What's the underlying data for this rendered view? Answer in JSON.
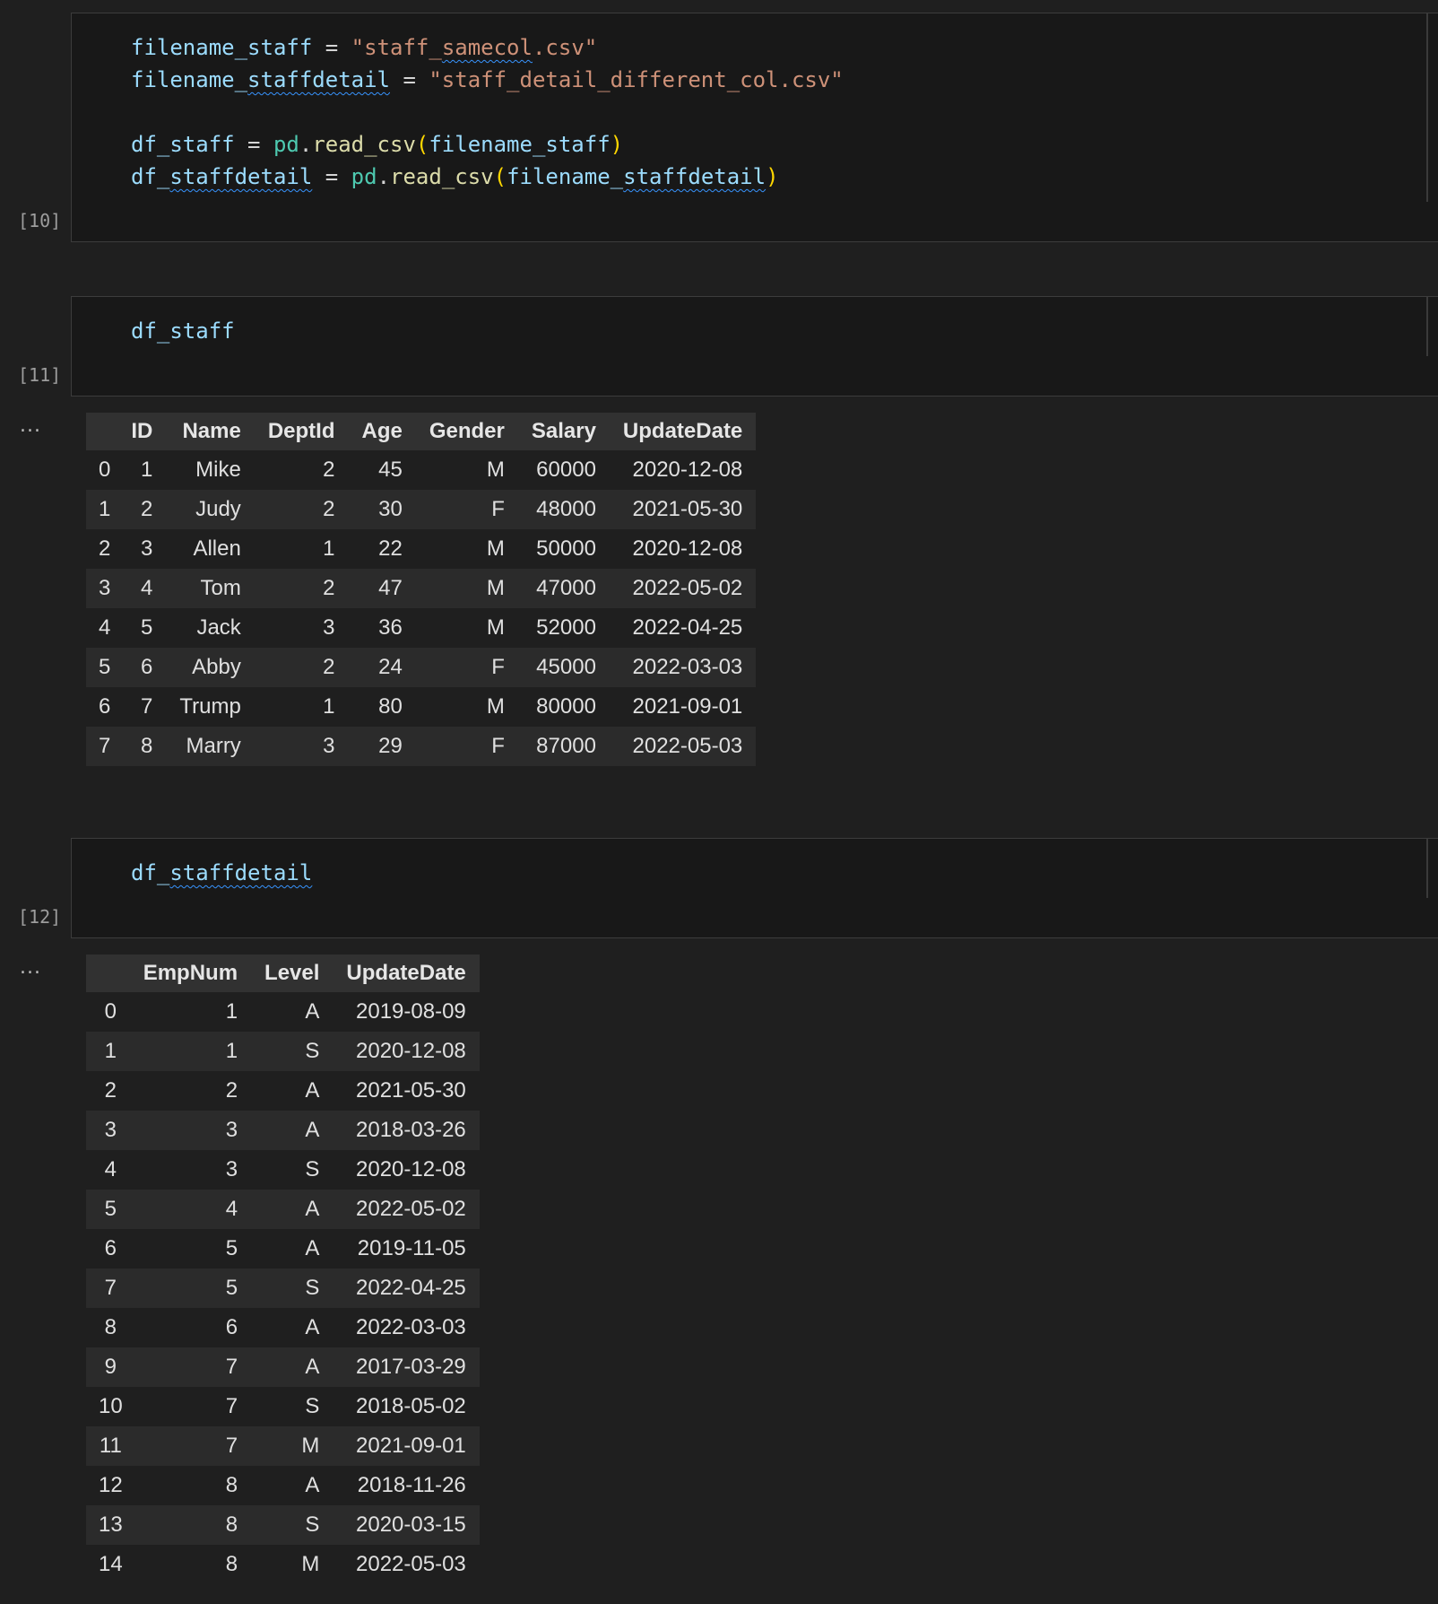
{
  "cells": [
    {
      "execution_count": "[10]",
      "code_lines": [
        [
          {
            "t": "filename_staff",
            "c": "v"
          },
          {
            "t": " = ",
            "c": "o"
          },
          {
            "t": "\"staff_",
            "c": "s"
          },
          {
            "t": "samecol",
            "c": "s",
            "squiggle": true
          },
          {
            "t": ".csv\"",
            "c": "s"
          }
        ],
        [
          {
            "t": "filename_",
            "c": "v"
          },
          {
            "t": "staffdetail",
            "c": "v",
            "squiggle": true
          },
          {
            "t": " = ",
            "c": "o"
          },
          {
            "t": "\"staff_detail_different_col.csv\"",
            "c": "s"
          }
        ],
        [],
        [
          {
            "t": "df_staff",
            "c": "v"
          },
          {
            "t": " = ",
            "c": "o"
          },
          {
            "t": "pd",
            "c": "m"
          },
          {
            "t": ".",
            "c": "o"
          },
          {
            "t": "read_csv",
            "c": "f"
          },
          {
            "t": "(",
            "c": "p"
          },
          {
            "t": "filename_staff",
            "c": "v"
          },
          {
            "t": ")",
            "c": "p"
          }
        ],
        [
          {
            "t": "df_",
            "c": "v"
          },
          {
            "t": "staffdetail",
            "c": "v",
            "squiggle": true
          },
          {
            "t": " = ",
            "c": "o"
          },
          {
            "t": "pd",
            "c": "m"
          },
          {
            "t": ".",
            "c": "o"
          },
          {
            "t": "read_csv",
            "c": "f"
          },
          {
            "t": "(",
            "c": "p"
          },
          {
            "t": "filename_",
            "c": "v"
          },
          {
            "t": "staffdetail",
            "c": "v",
            "squiggle": true
          },
          {
            "t": ")",
            "c": "p"
          }
        ]
      ]
    },
    {
      "execution_count": "[11]",
      "code_lines": [
        [
          {
            "t": "df_staff",
            "c": "v"
          }
        ]
      ],
      "output_marker": "...",
      "table": {
        "columns": [
          "",
          "ID",
          "Name",
          "DeptId",
          "Age",
          "Gender",
          "Salary",
          "UpdateDate"
        ],
        "rows": [
          [
            "0",
            "1",
            "Mike",
            "2",
            "45",
            "M",
            "60000",
            "2020-12-08"
          ],
          [
            "1",
            "2",
            "Judy",
            "2",
            "30",
            "F",
            "48000",
            "2021-05-30"
          ],
          [
            "2",
            "3",
            "Allen",
            "1",
            "22",
            "M",
            "50000",
            "2020-12-08"
          ],
          [
            "3",
            "4",
            "Tom",
            "2",
            "47",
            "M",
            "47000",
            "2022-05-02"
          ],
          [
            "4",
            "5",
            "Jack",
            "3",
            "36",
            "M",
            "52000",
            "2022-04-25"
          ],
          [
            "5",
            "6",
            "Abby",
            "2",
            "24",
            "F",
            "45000",
            "2022-03-03"
          ],
          [
            "6",
            "7",
            "Trump",
            "1",
            "80",
            "M",
            "80000",
            "2021-09-01"
          ],
          [
            "7",
            "8",
            "Marry",
            "3",
            "29",
            "F",
            "87000",
            "2022-05-03"
          ]
        ]
      }
    },
    {
      "execution_count": "[12]",
      "code_lines": [
        [
          {
            "t": "df_",
            "c": "v"
          },
          {
            "t": "staffdetail",
            "c": "v",
            "squiggle": true
          }
        ]
      ],
      "output_marker": "...",
      "table": {
        "columns": [
          "",
          "EmpNum",
          "Level",
          "UpdateDate"
        ],
        "rows": [
          [
            "0",
            "1",
            "A",
            "2019-08-09"
          ],
          [
            "1",
            "1",
            "S",
            "2020-12-08"
          ],
          [
            "2",
            "2",
            "A",
            "2021-05-30"
          ],
          [
            "3",
            "3",
            "A",
            "2018-03-26"
          ],
          [
            "4",
            "3",
            "S",
            "2020-12-08"
          ],
          [
            "5",
            "4",
            "A",
            "2022-05-02"
          ],
          [
            "6",
            "5",
            "A",
            "2019-11-05"
          ],
          [
            "7",
            "5",
            "S",
            "2022-04-25"
          ],
          [
            "8",
            "6",
            "A",
            "2022-03-03"
          ],
          [
            "9",
            "7",
            "A",
            "2017-03-29"
          ],
          [
            "10",
            "7",
            "S",
            "2018-05-02"
          ],
          [
            "11",
            "7",
            "M",
            "2021-09-01"
          ],
          [
            "12",
            "8",
            "A",
            "2018-11-26"
          ],
          [
            "13",
            "8",
            "S",
            "2020-03-15"
          ],
          [
            "14",
            "8",
            "M",
            "2022-05-03"
          ]
        ]
      }
    }
  ]
}
